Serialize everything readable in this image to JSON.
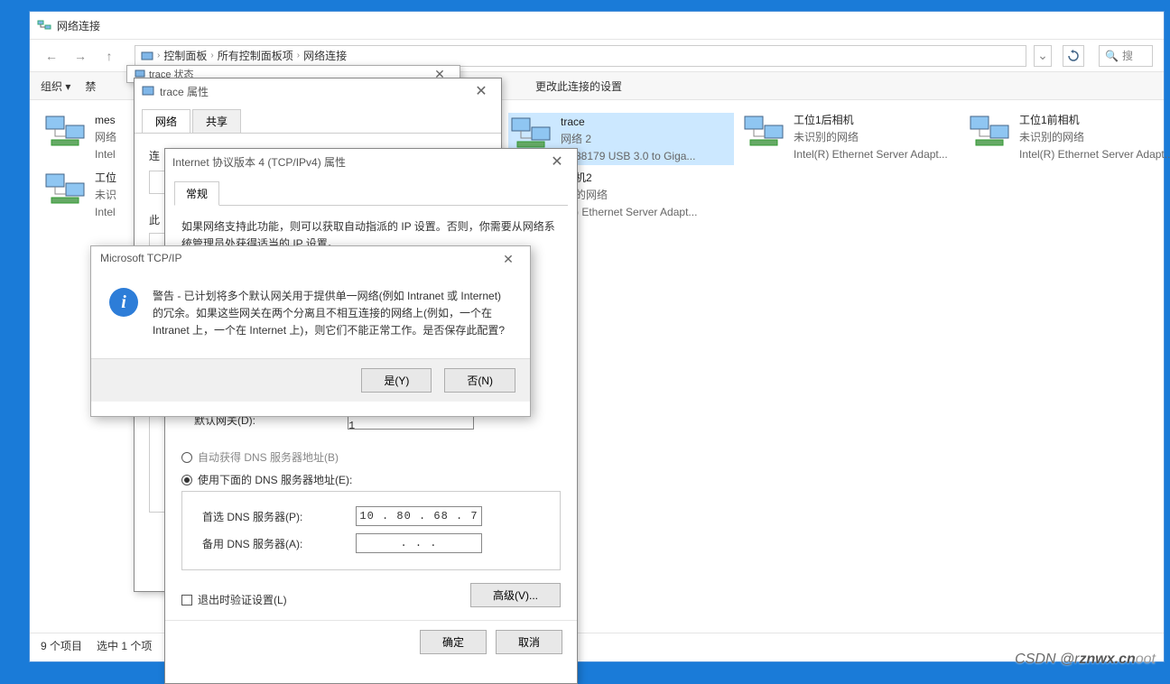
{
  "explorer": {
    "title": "网络连接",
    "breadcrumb": {
      "root_icon": "control-panel-icon",
      "p1": "控制面板",
      "p2": "所有控制面板项",
      "p3": "网络连接"
    },
    "search_placeholder": "搜",
    "search_icon_label": "🔍",
    "commands": {
      "organize": "组织 ▾",
      "disable": "禁",
      "change": "更改此连接的设置"
    },
    "status": {
      "count": "9 个项目",
      "selected": "选中 1 个项"
    }
  },
  "net_items": [
    {
      "name": "mes",
      "sub": "网络",
      "dev": "Intel"
    },
    {
      "name": "工位",
      "sub": "未识",
      "dev": "Intel"
    },
    {
      "name": "trace",
      "sub": "网络 2",
      "dev": "AX88179 USB 3.0 to Giga..."
    },
    {
      "name": "机2",
      "sub": "的网络",
      "dev": ") Ethernet Server Adapt..."
    },
    {
      "name": "工位1后相机",
      "sub": "未识别的网络",
      "dev": "Intel(R) Ethernet Server Adapt..."
    },
    {
      "name": "工位1前相机",
      "sub": "未识别的网络",
      "dev": "Intel(R) Ethernet Server Adapt..."
    }
  ],
  "trace_status": {
    "title": "trace 状态"
  },
  "trace_props": {
    "title": "trace 属性",
    "tabs": {
      "network": "网络",
      "share": "共享"
    },
    "connect_using": "连"
  },
  "ipv4": {
    "title": "Internet 协议版本 4 (TCP/IPv4) 属性",
    "tab_general": "常规",
    "desc": "如果网络支持此功能，则可以获取自动指派的 IP 设置。否则，你需要从网络系统管理员处获得适当的 IP 设置。",
    "gateway_label": "默认网关(D):",
    "gateway_value": "10 . 218 . 37 .  1",
    "dns_auto": "自动获得 DNS 服务器地址(B)",
    "dns_manual": "使用下面的 DNS 服务器地址(E):",
    "dns_pref_label": "首选 DNS 服务器(P):",
    "dns_pref_value": "10 . 80 . 68 .  7",
    "dns_alt_label": "备用 DNS 服务器(A):",
    "dns_alt_value": ".       .       .",
    "validate_exit": "退出时验证设置(L)",
    "advanced": "高级(V)...",
    "ok": "确定",
    "cancel": "取消"
  },
  "msgbox": {
    "title": "Microsoft TCP/IP",
    "text": "警告 - 已计划将多个默认网关用于提供单一网络(例如 Intranet 或 Internet)的冗余。如果这些网关在两个分离且不相互连接的网络上(例如，一个在 Intranet 上，一个在 Internet 上)，则它们不能正常工作。是否保存此配置?",
    "yes": "是(Y)",
    "no": "否(N)"
  },
  "watermark": {
    "csdn": "CSDN @r",
    "znwx": "znwx.cn",
    "tail": "oot"
  }
}
